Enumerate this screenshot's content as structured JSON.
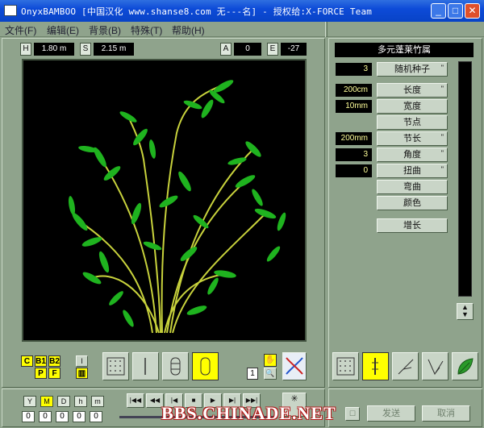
{
  "window": {
    "title": "OnyxBAMBOO [中国汉化 www.shanse8.com 无---名] - 授权给:X-FORCE Team",
    "min": "_",
    "max": "□",
    "close": "✕"
  },
  "menu": [
    "文件(F)",
    "编辑(E)",
    "背景(B)",
    "特殊(T)",
    "帮助(H)"
  ],
  "dims": {
    "h_label": "H",
    "h_value": "1.80 m",
    "s_label": "S",
    "s_value": "2.15 m",
    "a_label": "A",
    "a_value": "0",
    "e_label": "E",
    "e_value": "-27"
  },
  "species": "多元蓬莱竹属",
  "params": [
    {
      "value": "3",
      "label": "随机种子",
      "marker": "\""
    },
    {
      "value": "200cm",
      "label": "长度",
      "marker": "\""
    },
    {
      "value": "10mm",
      "label": "宽度",
      "marker": ""
    },
    {
      "value": "",
      "label": "节点",
      "marker": ""
    },
    {
      "value": "200mm",
      "label": "节长",
      "marker": "\""
    },
    {
      "value": "3",
      "label": "角度",
      "marker": "\""
    },
    {
      "value": "0",
      "label": "扭曲",
      "marker": "\""
    },
    {
      "value": "",
      "label": "弯曲",
      "marker": ""
    },
    {
      "value": "",
      "label": "颜色",
      "marker": ""
    }
  ],
  "grow_label": "增长",
  "display_toggles": {
    "c": "C",
    "b1": "B1",
    "b2": "B2",
    "p": "P",
    "f": "F",
    "i": "I"
  },
  "zoom_value": "1",
  "time": {
    "labels": [
      "Y",
      "M",
      "D",
      "h",
      "m"
    ],
    "values": [
      "0",
      "0",
      "0",
      "0",
      "0"
    ]
  },
  "send_label": "发送",
  "cancel_label": "取消",
  "watermark": "BBS.CHINADE.NET",
  "colors": {
    "titlebar": "#0d4bd8",
    "panel": "#8fa38c",
    "accent": "#ffff00",
    "leaf": "#1fb31f",
    "culm": "#c8d23c"
  }
}
